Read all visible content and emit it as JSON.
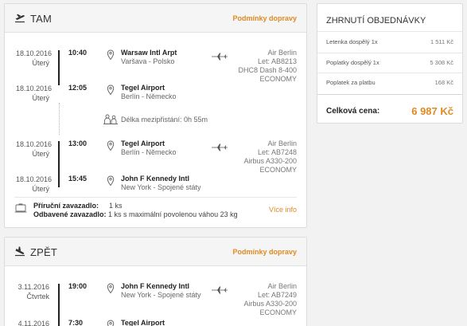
{
  "outbound": {
    "title": "TAM",
    "rules_link": "Podmínky dopravy",
    "seg1": {
      "dep": {
        "date": "18.10.2016",
        "day": "Úterý",
        "time": "10:40",
        "airport": "Warsaw Intl Arpt",
        "city": "Varšava - Polsko"
      },
      "arr": {
        "date": "18.10.2016",
        "day": "Úterý",
        "time": "12:05",
        "airport": "Tegel Airport",
        "city": "Berlín - Německo"
      },
      "carrier": {
        "airline": "Air Berlin",
        "flight": "Let: AB8213",
        "aircraft": "DHC8 Dash 8-400",
        "cabin": "ECONOMY"
      }
    },
    "layover": "Délka mezipřistání: 0h 55m",
    "seg2": {
      "dep": {
        "date": "18.10.2016",
        "day": "Úterý",
        "time": "13:00",
        "airport": "Tegel Airport",
        "city": "Berlín - Německo"
      },
      "arr": {
        "date": "18.10.2016",
        "day": "Úterý",
        "time": "15:45",
        "airport": "John F Kennedy Intl",
        "city": "New York - Spojené státy"
      },
      "carrier": {
        "airline": "Air Berlin",
        "flight": "Let: AB7248",
        "aircraft": "Airbus A330-200",
        "cabin": "ECONOMY"
      }
    },
    "baggage": {
      "hand_label": "Příruční zavazadlo:",
      "hand_value": "1 ks",
      "checked_label": "Odbavené zavazadlo:",
      "checked_value": "1 ks s maximální povolenou váhou 23 kg",
      "more": "Více info"
    }
  },
  "inbound": {
    "title": "ZPĚT",
    "rules_link": "Podmínky dopravy",
    "seg1": {
      "dep": {
        "date": "3.11.2016",
        "day": "Čtvrtek",
        "time": "19:00",
        "airport": "John F Kennedy Intl",
        "city": "New York - Spojené státy"
      },
      "arr": {
        "date": "4.11.2016",
        "time": "7:30",
        "airport": "Tegel Airport"
      },
      "carrier": {
        "airline": "Air Berlin",
        "flight": "Let: AB7249",
        "aircraft": "Airbus A330-200",
        "cabin": "ECONOMY"
      }
    }
  },
  "summary": {
    "title": "ZHRNUTÍ OBJEDNÁVKY",
    "rows": [
      {
        "label": "Letenka dospělý 1x",
        "value": "1 511 Kč"
      },
      {
        "label": "Poplatky dospělý 1x",
        "value": "5 308 Kč"
      },
      {
        "label": "Poplatek za platbu",
        "value": "168 Kč"
      }
    ],
    "total_label": "Celková cena:",
    "total_value": "6 987 Kč"
  },
  "colors": {
    "accent": "#e08a24",
    "text": "#333333",
    "border": "#dcdcdc"
  }
}
